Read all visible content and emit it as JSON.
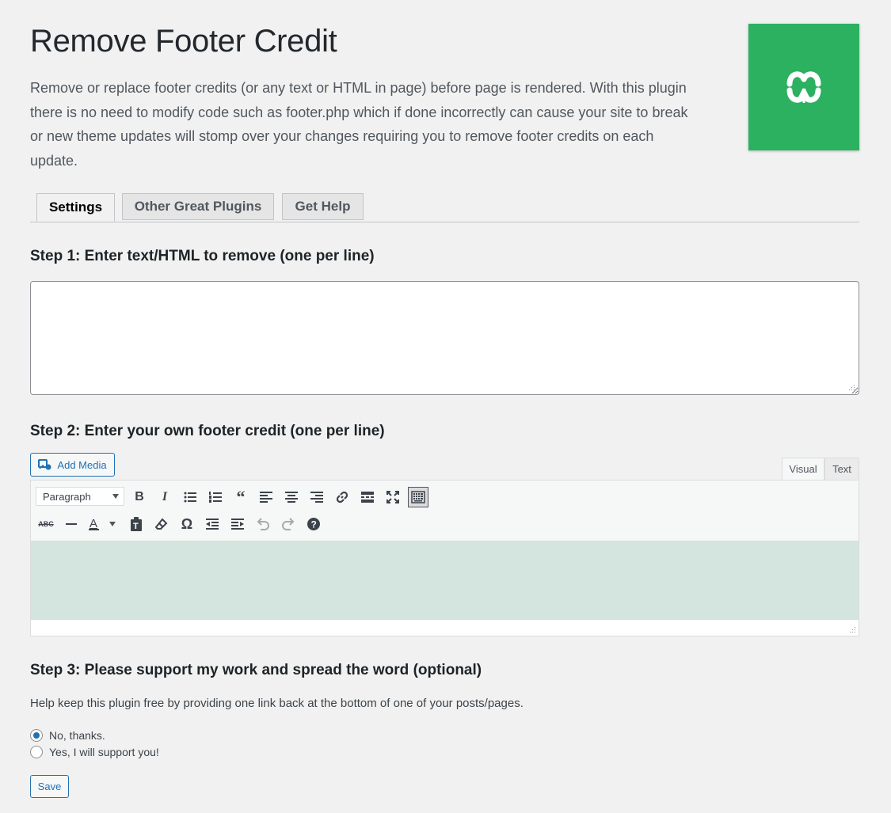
{
  "page": {
    "title": "Remove Footer Credit",
    "intro": "Remove or replace footer credits (or any text or HTML in page) before page is rendered. With this plugin there is no need to modify code such as footer.php which if done incorrectly can cause your site to break or new theme updates will stomp over your changes requiring you to remove footer credits on each update.",
    "logo_color": "#2bb160"
  },
  "tabs": [
    {
      "label": "Settings",
      "active": true
    },
    {
      "label": "Other Great Plugins",
      "active": false
    },
    {
      "label": "Get Help",
      "active": false
    }
  ],
  "step1": {
    "heading": "Step 1: Enter text/HTML to remove (one per line)",
    "value": ""
  },
  "step2": {
    "heading": "Step 2: Enter your own footer credit (one per line)",
    "add_media_label": "Add Media",
    "visual_tab": "Visual",
    "text_tab": "Text",
    "format_select": "Paragraph",
    "editor_bg": "#d3e5de",
    "toolbar_row1_icons": [
      "bold-icon",
      "italic-icon",
      "bullet-list-icon",
      "numbered-list-icon",
      "blockquote-icon",
      "align-left-icon",
      "align-center-icon",
      "align-right-icon",
      "link-icon",
      "read-more-icon",
      "fullscreen-icon",
      "toolbar-toggle-icon"
    ],
    "toolbar_row2_icons": [
      "strikethrough-icon",
      "horizontal-line-icon",
      "text-color-icon",
      "paste-text-icon",
      "clear-formatting-icon",
      "special-character-icon",
      "outdent-icon",
      "indent-icon",
      "undo-icon",
      "redo-icon",
      "help-icon"
    ]
  },
  "step3": {
    "heading": "Step 3: Please support my work and spread the word (optional)",
    "description": "Help keep this plugin free by providing one link back at the bottom of one of your posts/pages.",
    "options": [
      {
        "label": "No, thanks.",
        "checked": true
      },
      {
        "label": "Yes, I will support you!",
        "checked": false
      }
    ],
    "save_label": "Save"
  },
  "colors": {
    "accent": "#2271b1",
    "background": "#f1f1f1"
  }
}
